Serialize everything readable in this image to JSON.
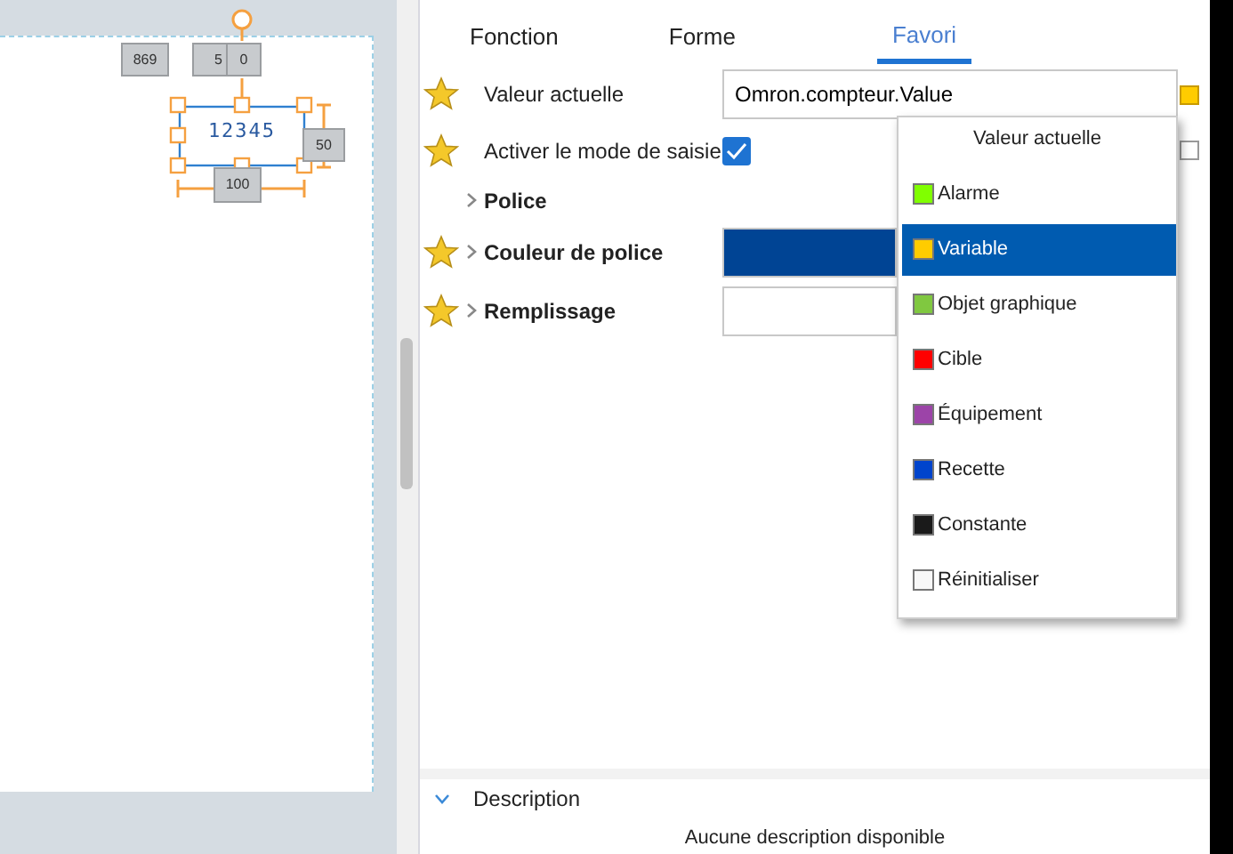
{
  "canvas": {
    "widget_text": "12345",
    "x_label": "869",
    "y_label": "5",
    "rotation_label": "0",
    "height_label": "50",
    "width_label": "100"
  },
  "tabs": [
    {
      "label": "Fonction",
      "selected": false
    },
    {
      "label": "Forme",
      "selected": false
    },
    {
      "label": "Favori",
      "selected": true
    }
  ],
  "properties": [
    {
      "kind": "text",
      "label": "Valeur actuelle",
      "favorite": true,
      "expandable": false,
      "value": "Omron.compteur.Value",
      "bound": true
    },
    {
      "kind": "checkbox",
      "label": "Activer le mode de saisie",
      "favorite": true,
      "expandable": false,
      "checked": true,
      "bound": false
    },
    {
      "kind": "group",
      "label": "Police",
      "favorite": false,
      "expandable": true
    },
    {
      "kind": "color",
      "label": "Couleur de police",
      "favorite": true,
      "expandable": true,
      "color": "#004494"
    },
    {
      "kind": "color",
      "label": "Remplissage",
      "favorite": true,
      "expandable": true,
      "color": "#ffffff"
    }
  ],
  "dropdown": {
    "title": "Valeur actuelle",
    "items": [
      {
        "label": "Alarme",
        "color": "#80ff00",
        "selected": false
      },
      {
        "label": "Variable",
        "color": "#ffcc00",
        "selected": true
      },
      {
        "label": "Objet graphique",
        "color": "#80c840",
        "selected": false
      },
      {
        "label": "Cible",
        "color": "#ff0000",
        "selected": false
      },
      {
        "label": "Équipement",
        "color": "#9c44a8",
        "selected": false
      },
      {
        "label": "Recette",
        "color": "#0044cc",
        "selected": false
      },
      {
        "label": "Constante",
        "color": "#1a1a1a",
        "selected": false
      },
      {
        "label": "Réinitialiser",
        "color": "#f8f8f8",
        "selected": false
      }
    ]
  },
  "description": {
    "title": "Description",
    "text": "Aucune description disponible"
  }
}
